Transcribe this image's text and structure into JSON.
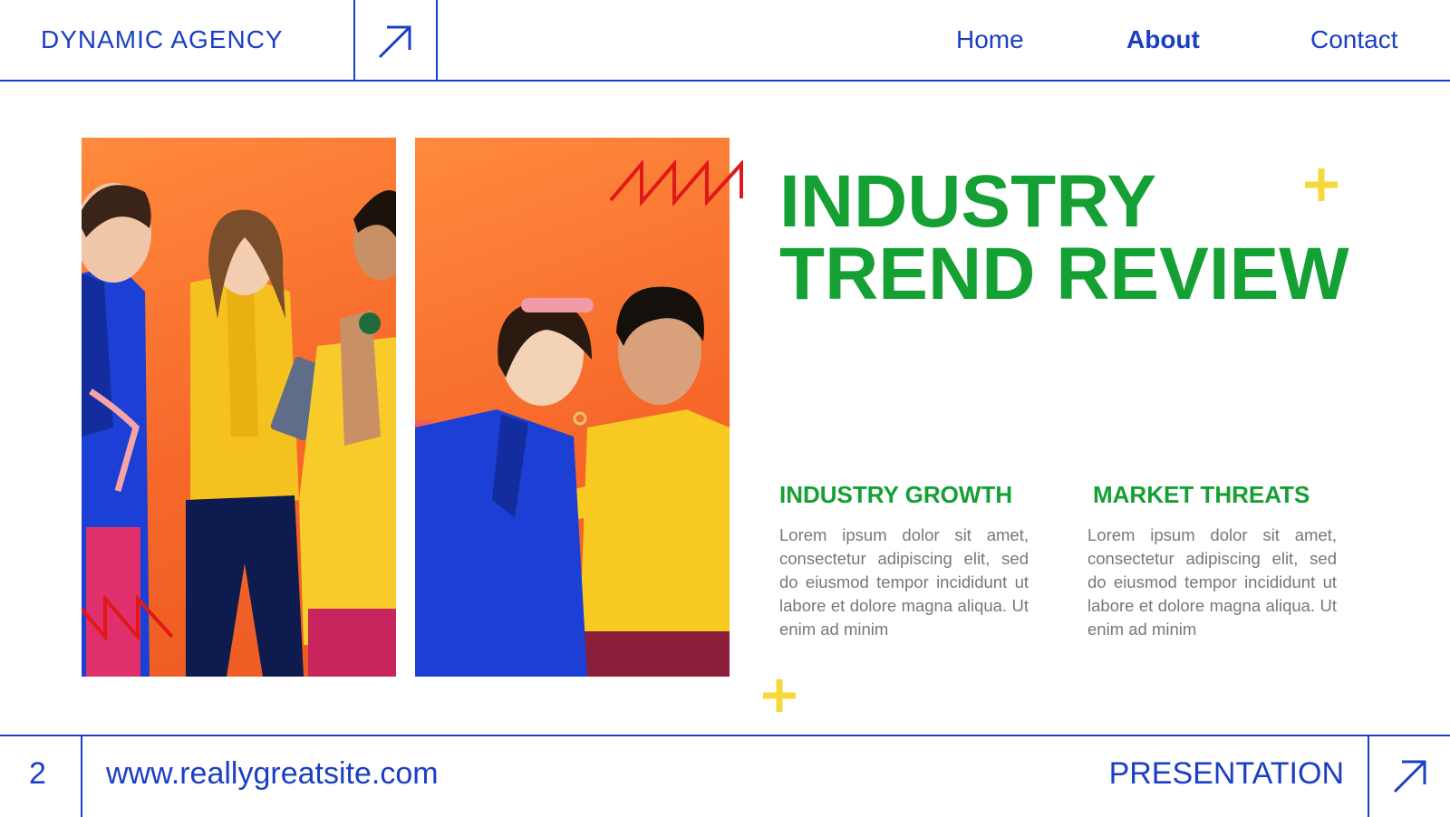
{
  "header": {
    "brand": "DYNAMIC AGENCY",
    "nav": [
      {
        "label": "Home"
      },
      {
        "label": "About"
      },
      {
        "label": "Contact"
      }
    ]
  },
  "main": {
    "title_line1": "INDUSTRY",
    "title_line2": "TREND REVIEW",
    "columns": [
      {
        "heading": "INDUSTRY GROWTH",
        "text": "Lorem ipsum dolor sit amet, consectetur adipiscing elit, sed do eiusmod tempor incididunt ut labore et dolore magna aliqua. Ut enim ad minim"
      },
      {
        "heading": "MARKET THREATS",
        "text": "Lorem ipsum dolor sit amet, consectetur adipiscing elit, sed do eiusmod tempor incididunt ut labore et dolore magna aliqua. Ut enim ad minim"
      }
    ]
  },
  "footer": {
    "page_number": "2",
    "website": "www.reallygreatsite.com",
    "label": "PRESENTATION"
  },
  "colors": {
    "brand_blue": "#1a3fc4",
    "title_green": "#14a033",
    "accent_yellow": "#f7d83a",
    "accent_red": "#e01818",
    "photo_orange": "#f6682a"
  },
  "icons": [
    "arrow-up-right-icon",
    "zigzag-decor-icon",
    "plus-decor-icon"
  ]
}
